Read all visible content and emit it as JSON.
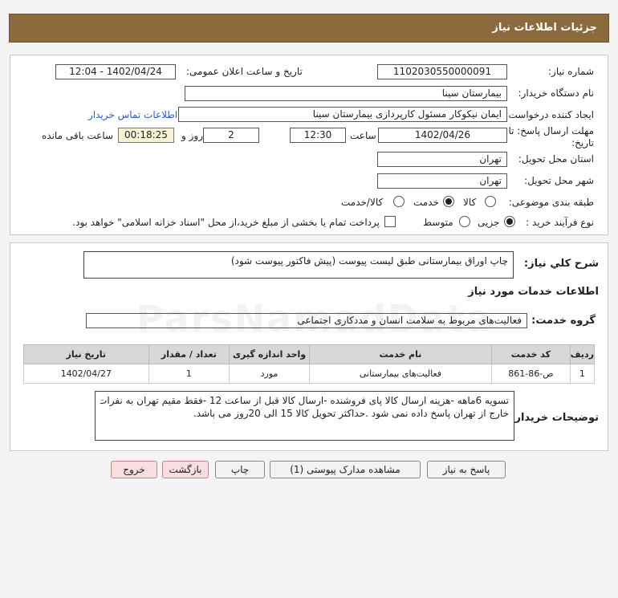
{
  "header": {
    "title": "جزئیات اطلاعات نیاز"
  },
  "info": {
    "need_number_label": "شماره نیاز:",
    "need_number": "1102030550000091",
    "announce_label": "تاریخ و ساعت اعلان عمومی:",
    "announce_value": "1402/04/24 - 12:04",
    "buyer_label": "نام دستگاه خریدار:",
    "buyer_value": "بیمارستان سینا",
    "creator_label": "ایجاد کننده درخواست:",
    "creator_value": "ایمان نیکوکار مسئول کارپردازی  بیمارستان سینا",
    "contact_link": "اطلاعات تماس خریدار",
    "deadline_label": "مهلت ارسال پاسخ: تا تاریخ:",
    "deadline_date": "1402/04/26",
    "time_label": "ساعت",
    "deadline_time": "12:30",
    "days_value": "2",
    "days_label": "روز و",
    "remaining_time": "00:18:25",
    "remaining_label": "ساعت باقی مانده",
    "province_label": "استان محل تحویل:",
    "province_value": "تهران",
    "city_label": "شهر محل تحویل:",
    "city_value": "تهران",
    "category_label": "طبقه بندی موضوعی:",
    "category_options": [
      "کالا",
      "خدمت",
      "کالا/خدمت"
    ],
    "category_selected": "خدمت",
    "process_label": "نوع فرآیند خرید :",
    "process_options": [
      "جزیی",
      "متوسط"
    ],
    "process_selected": "جزیی",
    "payment_note": "پرداخت تمام یا بخشی از مبلغ خرید،از محل \"اسناد خزانه اسلامی\" خواهد بود."
  },
  "summary": {
    "label": "شرح کلي نياز:",
    "value": "چاپ اوراق بیمارستانی طبق لیست پیوست (پیش فاکتور پیوست شود)",
    "services_title": "اطلاعات خدمات مورد نیاز",
    "group_label": "گروه خدمت:",
    "group_value": "فعالیت‌های مربوط به سلامت انسان و مددکاری اجتماعی"
  },
  "table": {
    "headers": [
      "ردیف",
      "کد خدمت",
      "نام خدمت",
      "واحد اندازه گیری",
      "تعداد / مقدار",
      "تاریخ نیاز"
    ],
    "rows": [
      [
        "1",
        "ص-86-861",
        "فعالیت‌های بیمارستانی",
        "مورد",
        "1",
        "1402/04/27"
      ]
    ]
  },
  "buyer_notes": {
    "label": "توضیحات خریدار:",
    "line1": "تسویه 6ماهه -هزینه ارسال کالا پای فروشنده -ارسال کالا قبل از ساعت 12 -فقط مقیم تهران به نفرات",
    "line2": "خارج از تهران پاسخ داده نمی شود .حداکثر تحویل کالا  15 الی 20روز می باشد."
  },
  "buttons": {
    "reply": "پاسخ به نیاز",
    "attachments": "مشاهده مدارک پیوستی (1)",
    "print": "چاپ",
    "back": "بازگشت",
    "exit": "خروج"
  },
  "watermark": "ParsNamadData"
}
